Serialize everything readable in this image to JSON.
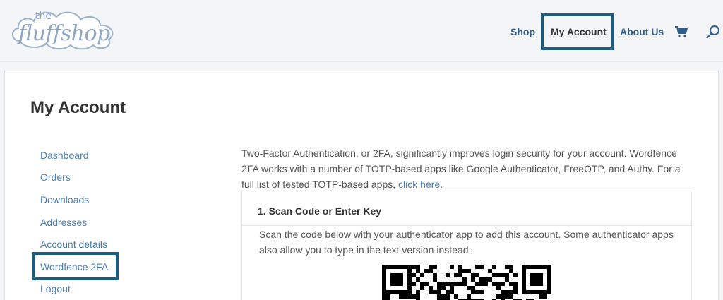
{
  "logo": {
    "small": "the",
    "word": "fluffshop"
  },
  "nav": {
    "shop": "Shop",
    "my_account": "My Account",
    "about_us": "About Us"
  },
  "page": {
    "title": "My Account"
  },
  "sidebar": {
    "items": [
      {
        "label": "Dashboard"
      },
      {
        "label": "Orders"
      },
      {
        "label": "Downloads"
      },
      {
        "label": "Addresses"
      },
      {
        "label": "Account details"
      },
      {
        "label": "Wordfence 2FA"
      },
      {
        "label": "Logout"
      }
    ]
  },
  "intro": {
    "text": "Two-Factor Authentication, or 2FA, significantly improves login security for your account. Wordfence 2FA works with a number of TOTP-based apps like Google Authenticator, FreeOTP, and Authy. For a full list of tested TOTP-based apps, ",
    "link": "click here",
    "end": "."
  },
  "panel": {
    "heading": "1. Scan Code or Enter Key",
    "text": "Scan the code below with your authenticator app to add this account. Some authenticator apps also allow you to type in the text version instead."
  },
  "colors": {
    "accent": "#1d5b80",
    "link": "#4a7db4",
    "nav": "#2f5d8c"
  },
  "icons": {
    "cart": "cart-icon",
    "search": "search-icon"
  }
}
